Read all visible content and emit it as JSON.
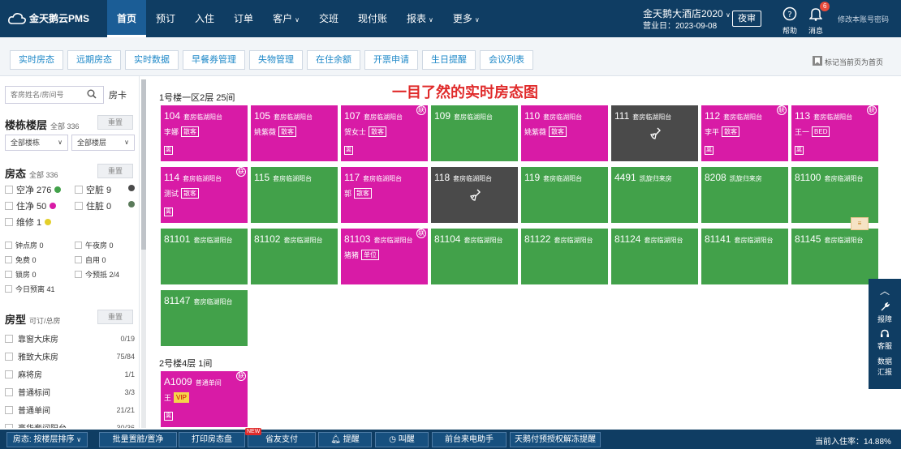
{
  "app": {
    "logo_text": "金天鹅云PMS"
  },
  "nav": {
    "home": "首页",
    "booking": "预订",
    "checkin": "入住",
    "orders": "订单",
    "customers": "客户",
    "shift": "交班",
    "cashbook": "现付账",
    "reports": "报表",
    "more": "更多"
  },
  "hotel": {
    "name": "金天鹅大酒店2020",
    "business_date": "营业日：2023-09-08"
  },
  "header": {
    "night_audit": "夜审",
    "help": "帮助",
    "messages": "消息",
    "message_count": "6",
    "change_password": "修改本账号密码"
  },
  "subtabs": [
    "实时房态",
    "远期房态",
    "实时数据",
    "早餐券管理",
    "失物管理",
    "在住余额",
    "开票申请",
    "生日提醒",
    "会议列表"
  ],
  "bookmark": "标记当前页为首页",
  "sidebar": {
    "search_placeholder": "客房姓名/房间号",
    "room_card": "房卡",
    "building": {
      "title": "楼栋楼层",
      "sub": "全部 336",
      "reset": "重置",
      "sel_building": "全部楼栋",
      "sel_floor": "全部楼层"
    },
    "status": {
      "title": "房态",
      "sub": "全部 336",
      "reset": "重置",
      "items": [
        {
          "label": "空净 276",
          "color": "#42a14a"
        },
        {
          "label": "空脏 9",
          "color": "#4a4a4a"
        },
        {
          "label": "住净 50",
          "color": "#d81ba6"
        },
        {
          "label": "住脏 0",
          "color": "#5a7a5a"
        },
        {
          "label": "维修 1",
          "color": "#e3cf2a"
        }
      ],
      "extras": [
        "钟点房 0",
        "午夜房 0",
        "免费 0",
        "自用 0",
        "锁房 0",
        "今预抵 2/4",
        "今日预离 41"
      ]
    },
    "roomtype": {
      "title": "房型",
      "sub": "可订/总房",
      "reset": "重置",
      "items": [
        {
          "name": "靠窗大床房",
          "count": "0/19"
        },
        {
          "name": "雅致大床房",
          "count": "75/84"
        },
        {
          "name": "麻将房",
          "count": "1/1"
        },
        {
          "name": "普通标间",
          "count": "3/3"
        },
        {
          "name": "普通单间",
          "count": "21/21"
        },
        {
          "name": "豪华套间阳台",
          "count": "30/36"
        }
      ]
    }
  },
  "main": {
    "heading": "一目了然的实时房态图",
    "floor1": "1号楼一区2层 25间",
    "floor2": "2号楼4层 1间",
    "tag_lian": "联",
    "tag_xu": "离",
    "rooms1": [
      {
        "no": "104",
        "type": "套房临湖阳台",
        "status": "pink",
        "guest": "李娜",
        "tag": "散客",
        "lian": false,
        "xu": true
      },
      {
        "no": "105",
        "type": "套房临湖阳台",
        "status": "pink",
        "guest": "姚紫薇",
        "tag": "散客",
        "lian": false,
        "xu": false
      },
      {
        "no": "107",
        "type": "套房临湖阳台",
        "status": "pink",
        "guest": "贺女士",
        "tag": "散客",
        "lian": true,
        "xu": true
      },
      {
        "no": "109",
        "type": "套房临湖阳台",
        "status": "green"
      },
      {
        "no": "110",
        "type": "套房临湖阳台",
        "status": "pink",
        "guest": "姚紫薇",
        "tag": "散客",
        "lian": false,
        "xu": false
      },
      {
        "no": "111",
        "type": "套房临湖阳台",
        "status": "dark"
      },
      {
        "no": "112",
        "type": "套房临湖阳台",
        "status": "pink",
        "guest": "李平",
        "tag": "散客",
        "lian": true,
        "xu": true
      },
      {
        "no": "113",
        "type": "套房临湖阳台",
        "status": "pink",
        "guest": "王一",
        "tag": "BED",
        "lian": true,
        "xu": true
      },
      {
        "no": "114",
        "type": "套房临湖阳台",
        "status": "pink",
        "guest": "测试",
        "tag": "散客",
        "lian": true,
        "xu": true
      },
      {
        "no": "115",
        "type": "套房临湖阳台",
        "status": "green"
      },
      {
        "no": "117",
        "type": "套房临湖阳台",
        "status": "pink",
        "guest": "郭",
        "tag": "散客",
        "lian": false,
        "xu": false
      },
      {
        "no": "118",
        "type": "套房临湖阳台",
        "status": "dark"
      },
      {
        "no": "119",
        "type": "套房临湖阳台",
        "status": "green"
      },
      {
        "no": "4491",
        "type": "凯旋归来房",
        "status": "green"
      },
      {
        "no": "8208",
        "type": "凯旋归来房",
        "status": "green"
      },
      {
        "no": "81100",
        "type": "套房临湖阳台",
        "status": "green"
      },
      {
        "no": "81101",
        "type": "套房临湖阳台",
        "status": "green"
      },
      {
        "no": "81102",
        "type": "套房临湖阳台",
        "status": "green"
      },
      {
        "no": "81103",
        "type": "套房临湖阳台",
        "status": "pink",
        "guest": "猪猪",
        "tag": "单位",
        "lian": true,
        "xu": false
      },
      {
        "no": "81104",
        "type": "套房临湖阳台",
        "status": "green"
      },
      {
        "no": "81122",
        "type": "套房临湖阳台",
        "status": "green"
      },
      {
        "no": "81124",
        "type": "套房临湖阳台",
        "status": "green"
      },
      {
        "no": "81141",
        "type": "套房临湖阳台",
        "status": "green"
      },
      {
        "no": "81145",
        "type": "套房临湖阳台",
        "status": "green"
      },
      {
        "no": "81147",
        "type": "套房临湖阳台",
        "status": "green"
      }
    ],
    "rooms2": [
      {
        "no": "A1009",
        "type": "普通单间",
        "status": "pink",
        "guest": "王",
        "tag": "VIP",
        "lian": true,
        "xu": true
      }
    ]
  },
  "rightfloat": {
    "report": "报障",
    "service": "客服",
    "data": "数据",
    "data2": "汇报"
  },
  "bottom": {
    "sort": "房态: 按楼层排序",
    "batch": "批量置脏/置净",
    "print": "打印房态盘",
    "new": "NEW",
    "friendpay": "省友支付",
    "remind": "提醒",
    "wake": "叫醒",
    "frontdesk": "前台来电助手",
    "prepay": "天鹅付预授权解冻提醒",
    "occupancy": "当前入住率：14.88%"
  }
}
